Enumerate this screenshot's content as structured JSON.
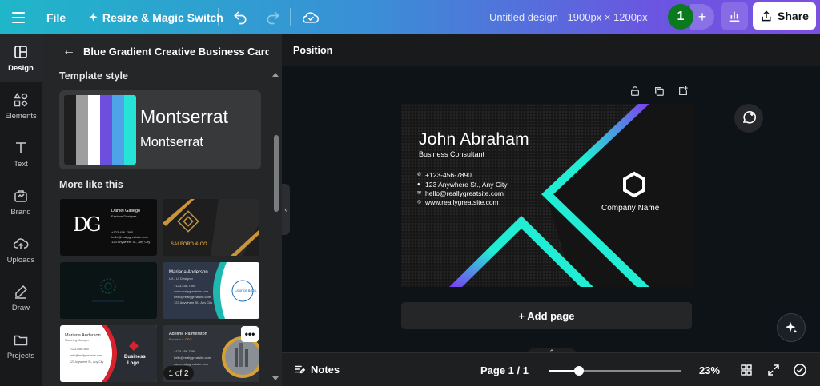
{
  "topbar": {
    "file_label": "File",
    "resize_label": "Resize & Magic Switch",
    "doc_title": "Untitled design - 1900px × 1200px",
    "avatar_initial": "1",
    "share_label": "Share"
  },
  "rail": {
    "items": [
      {
        "label": "Design",
        "icon": "layout-icon"
      },
      {
        "label": "Elements",
        "icon": "shapes-icon"
      },
      {
        "label": "Text",
        "icon": "text-icon"
      },
      {
        "label": "Brand",
        "icon": "brand-icon"
      },
      {
        "label": "Uploads",
        "icon": "upload-cloud-icon"
      },
      {
        "label": "Draw",
        "icon": "pen-icon"
      },
      {
        "label": "Projects",
        "icon": "folder-icon"
      }
    ]
  },
  "panel": {
    "title": "Blue Gradient Creative Business Card ...",
    "template_style_label": "Template style",
    "font_primary": "Montserrat",
    "font_secondary": "Montserrat",
    "swatch_colors": [
      "#1f1f1f",
      "#9e9e9e",
      "#ffffff",
      "#6c4fdc",
      "#4fa3e8",
      "#27e3d7"
    ],
    "more_label": "More like this",
    "pager": "1 of 2",
    "thumbs": [
      {
        "line1": "Daniel Gallego",
        "line2": "Fashion Designer",
        "line3": "+123-456-7890",
        "line4": "hello@reallygreatsite.com",
        "line5": "123 Anywhere St., Any City",
        "mark": "DG"
      },
      {
        "brand": "SALFORD & CO."
      },
      {},
      {
        "name": "Mariana Anderson",
        "role": "UX / UI Designer",
        "line1": "+123-456-7890",
        "line2": "www.reallygreatsite.com",
        "line3": "hello@reallygreatsite.com",
        "line4": "123 Anywhere St., Any City",
        "logo": "Licorice & Co."
      },
      {
        "name": "Mariana Anderson",
        "role": "Marketing Manager",
        "line1": "+123-456-7890",
        "line2": "hello@reallygreatsite.com",
        "line3": "123 Anywhere St., Any City",
        "logo_line1": "Business",
        "logo_line2": "Logo"
      },
      {
        "name": "Adeline Palmerston",
        "role": "Founder & CEO",
        "line1": "+123-456-7890",
        "line2": "hello@reallygreatsite.com",
        "line3": "www.reallygreatsite.com"
      }
    ]
  },
  "position_label": "Position",
  "card": {
    "name": "John Abraham",
    "role": "Business Consultant",
    "phone": "+123-456-7890",
    "address": "123 Anywhere St., Any City",
    "email": "hello@reallygreatsite.com",
    "web": "www.reallygreatsite.com",
    "company": "Company Name"
  },
  "add_page_label": "+ Add page",
  "bottombar": {
    "notes_label": "Notes",
    "page_label": "Page 1 / 1",
    "zoom_label": "23%",
    "zoom_slider_fraction": 0.23
  }
}
